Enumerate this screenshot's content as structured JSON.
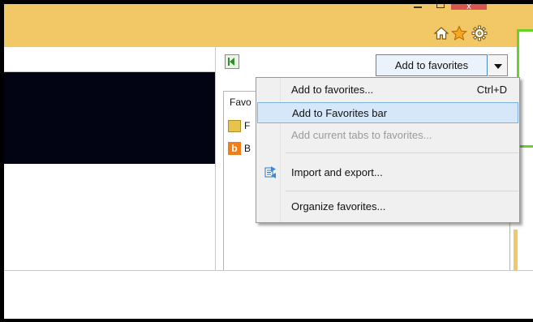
{
  "window": {
    "close_glyph": "x"
  },
  "command_bar": {
    "home_icon": "home-icon",
    "favorites_icon": "favorites-star-icon",
    "tools_icon": "gear-icon"
  },
  "favorites_center": {
    "pin_icon": "pin-to-left-icon",
    "add_button_label": "Add to favorites",
    "tab_label": "Favo",
    "items": [
      {
        "icon": "folder-icon",
        "label": "F"
      },
      {
        "icon": "bing-icon",
        "label": "B",
        "glyph": "b"
      }
    ]
  },
  "menu": {
    "items": [
      {
        "label": "Add to favorites...",
        "shortcut": "Ctrl+D"
      },
      {
        "label": "Add to Favorites bar"
      },
      {
        "label": "Add current tabs to favorites..."
      },
      {
        "label": "Import and export..."
      },
      {
        "label": "Organize favorites..."
      }
    ]
  },
  "colors": {
    "titlebar": "#f2c766",
    "highlight_border": "#6bd02a",
    "menu_hover": "#d5e7f8",
    "accent": "#4a86c8"
  }
}
